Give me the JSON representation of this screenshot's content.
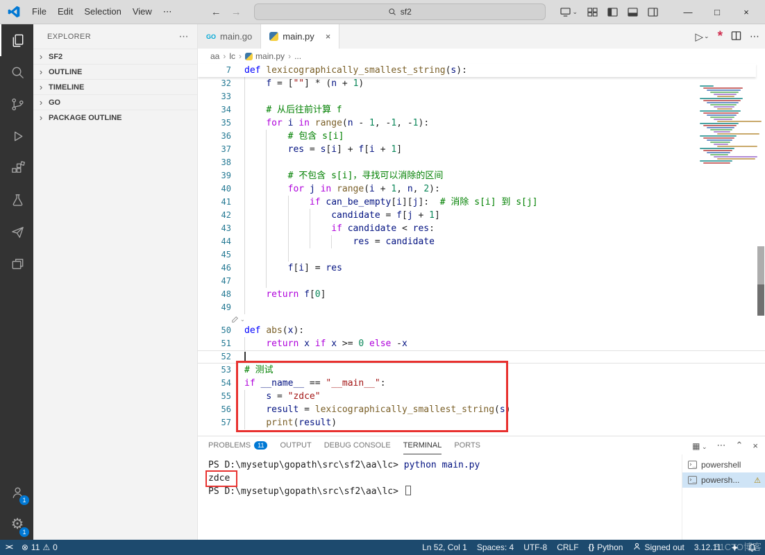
{
  "window": {
    "menus": [
      "File",
      "Edit",
      "Selection",
      "View"
    ],
    "menu_more": "⋯",
    "back": "←",
    "forward": "→",
    "search_value": "sf2",
    "controls": {
      "minimize": "—",
      "maximize": "□",
      "close": "×"
    }
  },
  "activity_bar": {
    "account_badge": "1",
    "settings_badge": "1"
  },
  "sidebar": {
    "title": "EXPLORER",
    "more": "⋯",
    "sections": [
      {
        "label": "SF2"
      },
      {
        "label": "OUTLINE"
      },
      {
        "label": "TIMELINE"
      },
      {
        "label": "GO"
      },
      {
        "label": "PACKAGE OUTLINE"
      }
    ]
  },
  "editor": {
    "tabs": [
      {
        "label": "main.go",
        "icon": "go"
      },
      {
        "label": "main.py",
        "icon": "python",
        "active": true,
        "close": "×"
      }
    ],
    "breadcrumb": [
      {
        "label": "aa"
      },
      {
        "label": "lc"
      },
      {
        "label": "main.py",
        "icon": "python"
      },
      {
        "label": "..."
      }
    ],
    "sticky": {
      "n": 7,
      "t": [
        [
          "def",
          "k"
        ],
        [
          " ",
          "d"
        ],
        [
          "lexicographically_smallest_string",
          "f"
        ],
        [
          "(",
          "d"
        ],
        [
          "s",
          "v"
        ],
        [
          "):",
          "d"
        ]
      ]
    },
    "lines": [
      {
        "n": 32,
        "g": 1,
        "t": [
          [
            "    ",
            "d"
          ],
          [
            "f",
            "v"
          ],
          [
            " = [",
            "d"
          ],
          [
            "\"\"",
            "s"
          ],
          [
            "] * (",
            "d"
          ],
          [
            "n",
            "v"
          ],
          [
            " + ",
            "d"
          ],
          [
            "1",
            "n"
          ],
          [
            ")",
            "d"
          ]
        ]
      },
      {
        "n": 33,
        "g": 1,
        "t": []
      },
      {
        "n": 34,
        "g": 1,
        "t": [
          [
            "    ",
            "d"
          ],
          [
            "# 从后往前计算 f",
            "m"
          ]
        ]
      },
      {
        "n": 35,
        "g": 1,
        "t": [
          [
            "    ",
            "d"
          ],
          [
            "for",
            "c"
          ],
          [
            " ",
            "d"
          ],
          [
            "i",
            "v"
          ],
          [
            " ",
            "d"
          ],
          [
            "in",
            "c"
          ],
          [
            " ",
            "d"
          ],
          [
            "range",
            "f"
          ],
          [
            "(",
            "d"
          ],
          [
            "n",
            "v"
          ],
          [
            " - ",
            "d"
          ],
          [
            "1",
            "n"
          ],
          [
            ", -",
            "d"
          ],
          [
            "1",
            "n"
          ],
          [
            ", -",
            "d"
          ],
          [
            "1",
            "n"
          ],
          [
            "):",
            "d"
          ]
        ]
      },
      {
        "n": 36,
        "g": 2,
        "t": [
          [
            "        ",
            "d"
          ],
          [
            "# 包含 s[i]",
            "m"
          ]
        ]
      },
      {
        "n": 37,
        "g": 2,
        "t": [
          [
            "        ",
            "d"
          ],
          [
            "res",
            "v"
          ],
          [
            " = ",
            "d"
          ],
          [
            "s",
            "v"
          ],
          [
            "[",
            "d"
          ],
          [
            "i",
            "v"
          ],
          [
            "] + ",
            "d"
          ],
          [
            "f",
            "v"
          ],
          [
            "[",
            "d"
          ],
          [
            "i",
            "v"
          ],
          [
            " + ",
            "d"
          ],
          [
            "1",
            "n"
          ],
          [
            "]",
            "d"
          ]
        ]
      },
      {
        "n": 38,
        "g": 2,
        "t": []
      },
      {
        "n": 39,
        "g": 2,
        "t": [
          [
            "        ",
            "d"
          ],
          [
            "# 不包含 s[i]，寻找可以消除的区间",
            "m"
          ]
        ]
      },
      {
        "n": 40,
        "g": 2,
        "t": [
          [
            "        ",
            "d"
          ],
          [
            "for",
            "c"
          ],
          [
            " ",
            "d"
          ],
          [
            "j",
            "v"
          ],
          [
            " ",
            "d"
          ],
          [
            "in",
            "c"
          ],
          [
            " ",
            "d"
          ],
          [
            "range",
            "f"
          ],
          [
            "(",
            "d"
          ],
          [
            "i",
            "v"
          ],
          [
            " + ",
            "d"
          ],
          [
            "1",
            "n"
          ],
          [
            ", ",
            "d"
          ],
          [
            "n",
            "v"
          ],
          [
            ", ",
            "d"
          ],
          [
            "2",
            "n"
          ],
          [
            "):",
            "d"
          ]
        ]
      },
      {
        "n": 41,
        "g": 3,
        "t": [
          [
            "            ",
            "d"
          ],
          [
            "if",
            "c"
          ],
          [
            " ",
            "d"
          ],
          [
            "can_be_empty",
            "v"
          ],
          [
            "[",
            "d"
          ],
          [
            "i",
            "v"
          ],
          [
            "][",
            "d"
          ],
          [
            "j",
            "v"
          ],
          [
            "]:  ",
            "d"
          ],
          [
            "# 消除 s[i] 到 s[j]",
            "m"
          ]
        ]
      },
      {
        "n": 42,
        "g": 4,
        "t": [
          [
            "                ",
            "d"
          ],
          [
            "candidate",
            "v"
          ],
          [
            " = ",
            "d"
          ],
          [
            "f",
            "v"
          ],
          [
            "[",
            "d"
          ],
          [
            "j",
            "v"
          ],
          [
            " + ",
            "d"
          ],
          [
            "1",
            "n"
          ],
          [
            "]",
            "d"
          ]
        ]
      },
      {
        "n": 43,
        "g": 4,
        "t": [
          [
            "                ",
            "d"
          ],
          [
            "if",
            "c"
          ],
          [
            " ",
            "d"
          ],
          [
            "candidate",
            "v"
          ],
          [
            " < ",
            "d"
          ],
          [
            "res",
            "v"
          ],
          [
            ":",
            "d"
          ]
        ]
      },
      {
        "n": 44,
        "g": 5,
        "t": [
          [
            "                    ",
            "d"
          ],
          [
            "res",
            "v"
          ],
          [
            " = ",
            "d"
          ],
          [
            "candidate",
            "v"
          ]
        ]
      },
      {
        "n": 45,
        "g": 3,
        "t": []
      },
      {
        "n": 46,
        "g": 2,
        "t": [
          [
            "        ",
            "d"
          ],
          [
            "f",
            "v"
          ],
          [
            "[",
            "d"
          ],
          [
            "i",
            "v"
          ],
          [
            "] = ",
            "d"
          ],
          [
            "res",
            "v"
          ]
        ]
      },
      {
        "n": 47,
        "g": 2,
        "t": []
      },
      {
        "n": 48,
        "g": 1,
        "t": [
          [
            "    ",
            "d"
          ],
          [
            "return",
            "c"
          ],
          [
            " ",
            "d"
          ],
          [
            "f",
            "v"
          ],
          [
            "[",
            "d"
          ],
          [
            "0",
            "n"
          ],
          [
            "]",
            "d"
          ]
        ]
      },
      {
        "n": 49,
        "g": 1,
        "t": []
      },
      {
        "gap": true
      },
      {
        "n": 50,
        "g": 0,
        "t": [
          [
            "def",
            "k"
          ],
          [
            " ",
            "d"
          ],
          [
            "abs",
            "f"
          ],
          [
            "(",
            "d"
          ],
          [
            "x",
            "v"
          ],
          [
            "):",
            "d"
          ]
        ]
      },
      {
        "n": 51,
        "g": 1,
        "t": [
          [
            "    ",
            "d"
          ],
          [
            "return",
            "c"
          ],
          [
            " ",
            "d"
          ],
          [
            "x",
            "v"
          ],
          [
            " ",
            "d"
          ],
          [
            "if",
            "c"
          ],
          [
            " ",
            "d"
          ],
          [
            "x",
            "v"
          ],
          [
            " >= ",
            "d"
          ],
          [
            "0",
            "n"
          ],
          [
            " ",
            "d"
          ],
          [
            "else",
            "c"
          ],
          [
            " -",
            "d"
          ],
          [
            "x",
            "v"
          ]
        ]
      },
      {
        "n": 52,
        "g": 0,
        "t": [],
        "cur": true
      },
      {
        "n": 53,
        "g": 0,
        "t": [
          [
            "# 测试",
            "m"
          ]
        ]
      },
      {
        "n": 54,
        "g": 0,
        "t": [
          [
            "if",
            "c"
          ],
          [
            " ",
            "d"
          ],
          [
            "__name__",
            "v"
          ],
          [
            " == ",
            "d"
          ],
          [
            "\"__main__\"",
            "s"
          ],
          [
            ":",
            "d"
          ]
        ]
      },
      {
        "n": 55,
        "g": 1,
        "t": [
          [
            "    ",
            "d"
          ],
          [
            "s",
            "v"
          ],
          [
            " = ",
            "d"
          ],
          [
            "\"zdce\"",
            "s"
          ]
        ]
      },
      {
        "n": 56,
        "g": 1,
        "t": [
          [
            "    ",
            "d"
          ],
          [
            "result",
            "v"
          ],
          [
            " = ",
            "d"
          ],
          [
            "lexicographically_smallest_string",
            "f"
          ],
          [
            "(",
            "d"
          ],
          [
            "s",
            "v"
          ],
          [
            ")",
            "d"
          ]
        ]
      },
      {
        "n": 57,
        "g": 1,
        "t": [
          [
            "    ",
            "d"
          ],
          [
            "print",
            "f"
          ],
          [
            "(",
            "d"
          ],
          [
            "result",
            "v"
          ],
          [
            ")",
            "d"
          ]
        ]
      }
    ]
  },
  "panel": {
    "tabs": [
      {
        "label": "PROBLEMS",
        "badge": "11"
      },
      {
        "label": "OUTPUT"
      },
      {
        "label": "DEBUG CONSOLE"
      },
      {
        "label": "TERMINAL",
        "active": true
      },
      {
        "label": "PORTS"
      }
    ],
    "terminal_lines": [
      {
        "t": [
          [
            "PS D:\\mysetup\\gopath\\src\\sf2\\aa\\lc> ",
            "t"
          ],
          [
            "python main.py",
            "cmd"
          ]
        ]
      },
      {
        "t": [
          [
            "zdce",
            "t"
          ]
        ],
        "boxed": true
      },
      {
        "t": [
          [
            "PS D:\\mysetup\\gopath\\src\\sf2\\aa\\lc> ",
            "t"
          ]
        ],
        "cursor": true
      }
    ],
    "terminals": [
      {
        "label": "powershell"
      },
      {
        "label": "powersh...",
        "selected": true,
        "warning": true
      }
    ]
  },
  "status_bar": {
    "errors": "11",
    "warnings": "0",
    "items": [
      {
        "id": "cursor-position",
        "label": "Ln 52, Col 1"
      },
      {
        "id": "indentation",
        "label": "Spaces: 4"
      },
      {
        "id": "encoding",
        "label": "UTF-8"
      },
      {
        "id": "eol",
        "label": "CRLF"
      },
      {
        "id": "language",
        "label": "Python",
        "icon": "braces"
      },
      {
        "id": "accounts",
        "label": "Signed out",
        "icon": "person"
      },
      {
        "id": "python-version",
        "label": "3.12.11"
      }
    ]
  },
  "watermark": "51CTO博客",
  "colors": {
    "accent": "#0078d4",
    "annotation_red": "#e8312f",
    "statusbar": "#1d4a6e"
  }
}
